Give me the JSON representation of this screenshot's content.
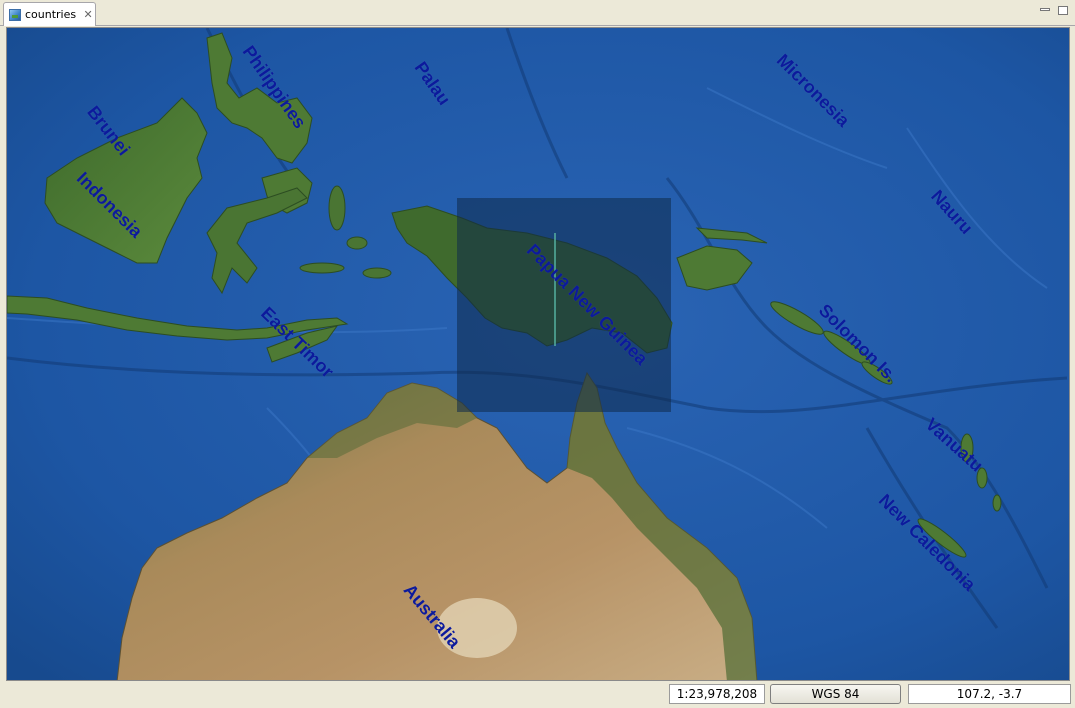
{
  "tab": {
    "title": "countries",
    "icon": "map-icon",
    "close_icon": "close-icon"
  },
  "window_controls": {
    "minimize_icon": "minimize-icon",
    "maximize_icon": "maximize-icon"
  },
  "map": {
    "layer": "countries",
    "labels": [
      {
        "id": "brunei",
        "text": "Brunei"
      },
      {
        "id": "indonesia",
        "text": "Indonesia"
      },
      {
        "id": "philippines",
        "text": "Philippines"
      },
      {
        "id": "palau",
        "text": "Palau"
      },
      {
        "id": "micronesia",
        "text": "Micronesia"
      },
      {
        "id": "nauru",
        "text": "Nauru"
      },
      {
        "id": "papua-new-guinea",
        "text": "Papua New Guinea"
      },
      {
        "id": "east-timor",
        "text": "East Timor"
      },
      {
        "id": "solomon-is",
        "text": "Solomon Is."
      },
      {
        "id": "vanuatu",
        "text": "Vanuatu"
      },
      {
        "id": "new-caledonia",
        "text": "New Caledonia"
      },
      {
        "id": "australia",
        "text": "Australia"
      }
    ],
    "selected_feature": "Papua New Guinea",
    "colors": {
      "ocean": "#1b4f9a",
      "label": "#0c1a9c",
      "selection_fill": "#0f2a4a"
    }
  },
  "status": {
    "scale": "1:23,978,208",
    "crs": "WGS 84",
    "coordinates": "107.2, -3.7"
  }
}
